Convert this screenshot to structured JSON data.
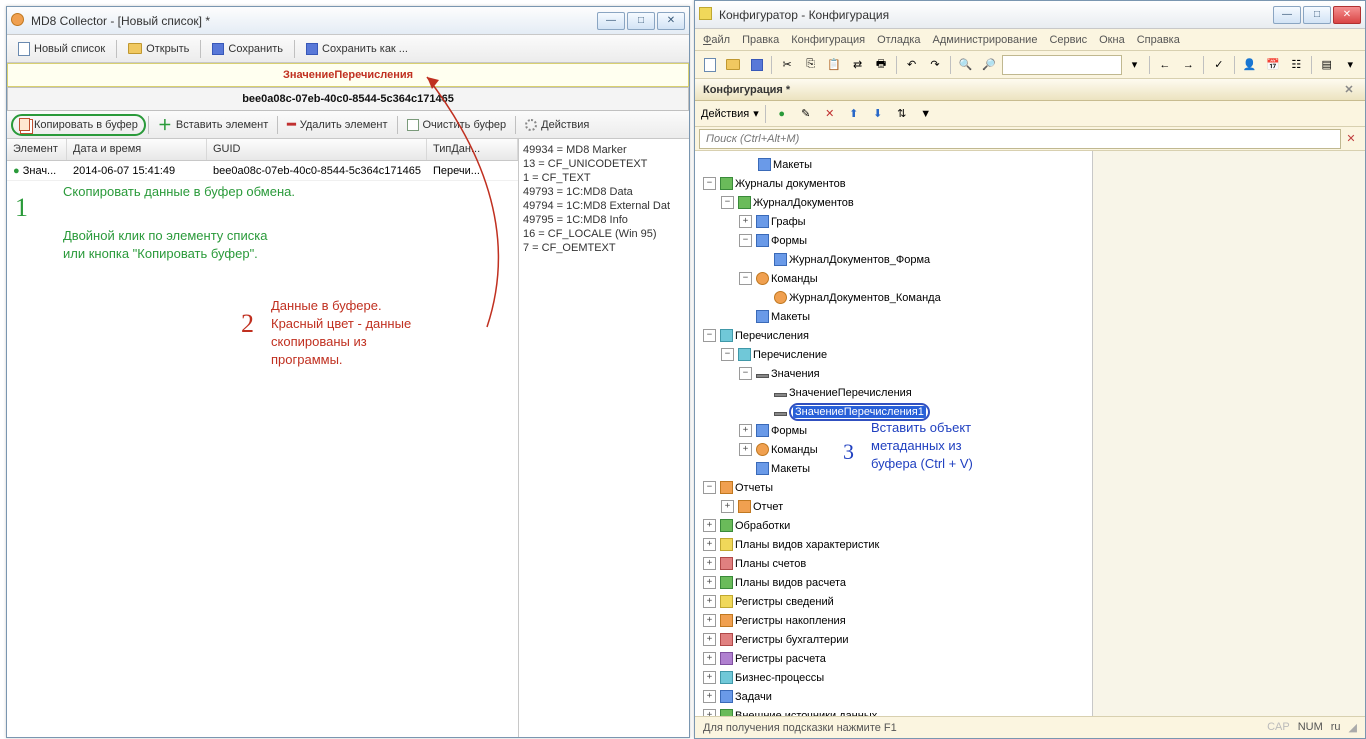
{
  "left": {
    "title": "MD8 Collector - [Новый список] *",
    "toolbar": {
      "new": "Новый список",
      "open": "Открыть",
      "save": "Сохранить",
      "saveas": "Сохранить как ..."
    },
    "yellow": "ЗначениеПеречисления",
    "guid": "bee0a08c-07eb-40c0-8544-5c364c171465",
    "toolbar2": {
      "copy": "Копировать в буфер",
      "insert": "Вставить элемент",
      "delete": "Удалить элемент",
      "clear": "Очистить буфер",
      "actions": "Действия"
    },
    "cols": {
      "c1": "Элемент",
      "c2": "Дата и время",
      "c3": "GUID",
      "c4": "ТипДан..."
    },
    "row": {
      "c1": "Знач...",
      "c2": "2014-06-07 15:41:49",
      "c3": "bee0a08c-07eb-40c0-8544-5c364c171465",
      "c4": "Перечи..."
    },
    "formats": "49934 = MD8 Marker\n13 = CF_UNICODETEXT\n1 = CF_TEXT\n49793 = 1C:MD8 Data\n49794 = 1C:MD8 External Dat\n49795 = 1C:MD8 Info\n16 = CF_LOCALE (Win 95)\n7 = CF_OEMTEXT",
    "annot1_num": "1",
    "annot1a": "Скопировать данные в буфер обмена.",
    "annot1b": "Двойной клик по элементу списка\nили кнопка \"Копировать буфер\".",
    "annot2_num": "2",
    "annot2": "Данные в буфере.\nКрасный цвет - данные\nскопированы из\nпрограммы."
  },
  "right": {
    "title": "Конфигуратор - Конфигурация",
    "menu": {
      "file": "Файл",
      "edit": "Правка",
      "config": "Конфигурация",
      "debug": "Отладка",
      "admin": "Администрирование",
      "service": "Сервис",
      "windows": "Окна",
      "help": "Справка"
    },
    "pane": "Конфигурация *",
    "actions": "Действия",
    "search_ph": "Поиск (Ctrl+Alt+M)",
    "tree": {
      "makety": "Макеты",
      "journals": "Журналы документов",
      "journal1": "ЖурналДокументов",
      "grafy": "Графы",
      "formy": "Формы",
      "jdform": "ЖурналДокументов_Форма",
      "komandy": "Команды",
      "jdkom": "ЖурналДокументов_Команда",
      "makety2": "Макеты",
      "perech": "Перечисления",
      "perech1": "Перечисление",
      "znach": "Значения",
      "zp": "ЗначениеПеречисления",
      "zp1": "ЗначениеПеречисления1",
      "formy2": "Формы",
      "komandy2": "Команды",
      "makety3": "Макеты",
      "otchety": "Отчеты",
      "otchet": "Отчет",
      "obrab": "Обработки",
      "pvh": "Планы видов характеристик",
      "ps": "Планы счетов",
      "pvr": "Планы видов расчета",
      "rs": "Регистры сведений",
      "rn": "Регистры накопления",
      "rb": "Регистры бухгалтерии",
      "rr": "Регистры расчета",
      "bp": "Бизнес-процессы",
      "zad": "Задачи",
      "vid": "Внешние источники данных"
    },
    "annot3_num": "3",
    "annot3": "Вставить объект\nметаданных из\nбуфера (Ctrl + V)",
    "status": "Для получения подсказки нажмите F1",
    "cap": "CAP",
    "num": "NUM",
    "lang": "ru"
  }
}
